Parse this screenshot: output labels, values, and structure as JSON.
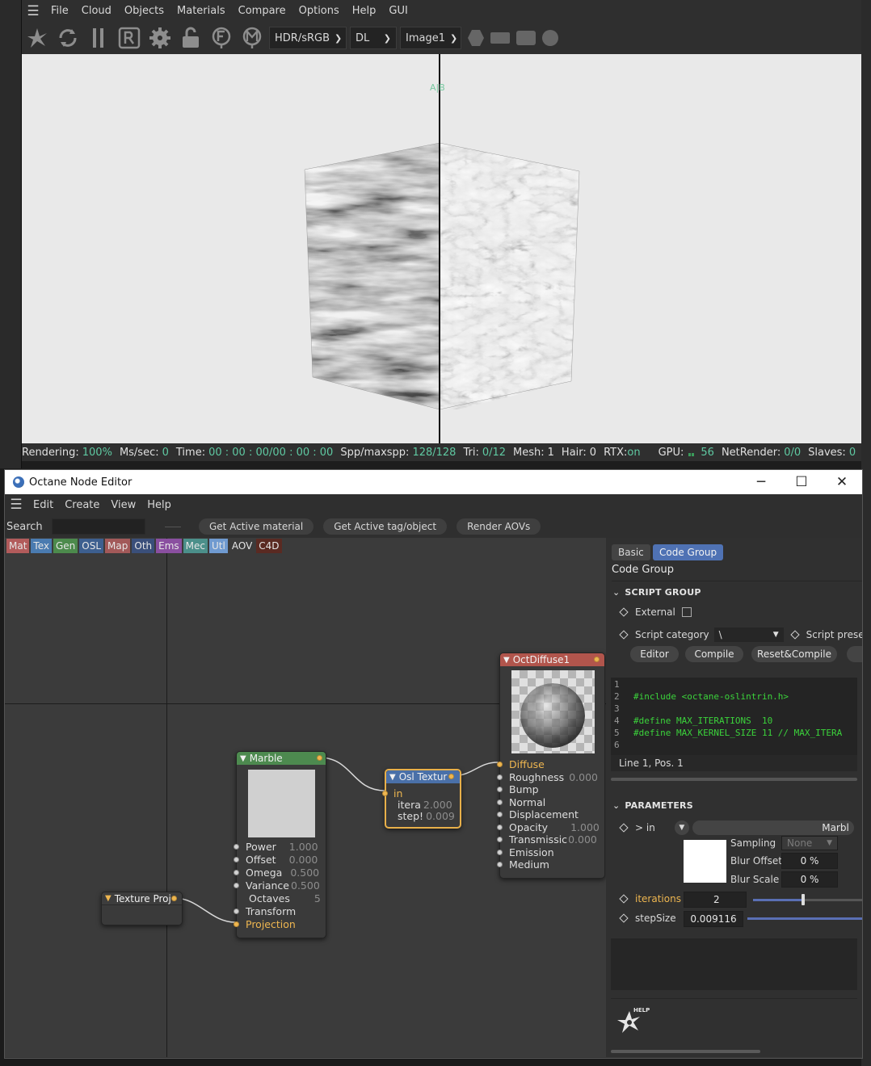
{
  "live_viewer": {
    "menu": [
      "File",
      "Cloud",
      "Objects",
      "Materials",
      "Compare",
      "Options",
      "Help",
      "GUI"
    ],
    "toolbar": {
      "color_space": "HDR/sRGB",
      "kernel": "DL",
      "image": "Image1"
    },
    "viewport": {
      "ab_label": "A|B"
    },
    "status": [
      {
        "label": "Rendering:",
        "value": "100%"
      },
      {
        "label": "Ms/sec:",
        "value": "0"
      },
      {
        "label": "Time:",
        "value": "00 : 00 : 00/00 : 00 : 00"
      },
      {
        "label": "Spp/maxspp:",
        "value": "128/128"
      },
      {
        "label": "Tri:",
        "value": "0/12"
      },
      {
        "label": "Mesh:",
        "value": "1"
      },
      {
        "label": "Hair:",
        "value": "0"
      },
      {
        "label": "RTX:",
        "value": "on"
      },
      {
        "label": "GPU:",
        "value": "56"
      },
      {
        "label": "NetRender:",
        "value": "0/0"
      },
      {
        "label": "Slaves:",
        "value": "0"
      }
    ]
  },
  "node_editor": {
    "title": "Octane Node Editor",
    "menu": [
      "Edit",
      "Create",
      "View",
      "Help"
    ],
    "toolbar": {
      "search_label": "Search",
      "search_value": "",
      "buttons": [
        "Get Active material",
        "Get Active tag/object",
        "Render AOVs"
      ]
    },
    "categories": [
      {
        "label": "Mat",
        "color": "#b25b5b"
      },
      {
        "label": "Tex",
        "color": "#4a7bb0"
      },
      {
        "label": "Gen",
        "color": "#4c8a4c"
      },
      {
        "label": "OSL",
        "color": "#3d5f8f"
      },
      {
        "label": "Map",
        "color": "#a25959"
      },
      {
        "label": "Oth",
        "color": "#3a4f7a"
      },
      {
        "label": "Ems",
        "color": "#8a4fa0"
      },
      {
        "label": "Mec",
        "color": "#4b8f8a"
      },
      {
        "label": "Utl",
        "color": "#6f9ad0"
      },
      {
        "label": "AOV",
        "color": "#3b3b3b"
      },
      {
        "label": "C4D",
        "color": "#5a2a22"
      }
    ],
    "nodes": {
      "diffuse": {
        "title": "OctDiffuse1",
        "pins": [
          {
            "label": "Diffuse",
            "value": "",
            "highlight": true
          },
          {
            "label": "Roughness",
            "value": "0.000"
          },
          {
            "label": "Bump",
            "value": ""
          },
          {
            "label": "Normal",
            "value": ""
          },
          {
            "label": "Displacement",
            "value": ""
          },
          {
            "label": "Opacity",
            "value": "1.000"
          },
          {
            "label": "Transmissic",
            "value": "0.000"
          },
          {
            "label": "Emission",
            "value": ""
          },
          {
            "label": "Medium",
            "value": ""
          }
        ]
      },
      "marble": {
        "title": "Marble",
        "pins": [
          {
            "label": "Power",
            "value": "1.000"
          },
          {
            "label": "Offset",
            "value": "0.000"
          },
          {
            "label": "Omega",
            "value": "0.500"
          },
          {
            "label": "Variance",
            "value": "0.500"
          },
          {
            "label": "Octaves",
            "value": "5"
          },
          {
            "label": "Transform",
            "value": ""
          },
          {
            "label": "Projection",
            "value": "",
            "highlight": true
          }
        ]
      },
      "osl": {
        "title": "Osl Textur",
        "pins": [
          {
            "label": "in",
            "value": "",
            "highlight": true
          },
          {
            "label": "itera",
            "value": "2.000"
          },
          {
            "label": "step!",
            "value": "0.009"
          }
        ]
      },
      "proj": {
        "title": "Texture Proj"
      }
    },
    "props": {
      "tabs": [
        "Basic",
        "Code Group"
      ],
      "panel_title": "Code Group",
      "script_group": "SCRIPT GROUP",
      "external_label": "External",
      "script_category_label": "Script category",
      "script_category_value": "\\",
      "script_presets_label": "Script presets",
      "buttons": [
        "Editor",
        "Compile",
        "Reset&Compile"
      ],
      "code": [
        {
          "n": "1",
          "t": ""
        },
        {
          "n": "2",
          "t": "#include <octane-oslintrin.h>"
        },
        {
          "n": "3",
          "t": ""
        },
        {
          "n": "4",
          "t": "#define MAX_ITERATIONS  10"
        },
        {
          "n": "5",
          "t": "#define MAX_KERNEL_SIZE 11 // MAX_ITERA"
        },
        {
          "n": "6",
          "t": ""
        }
      ],
      "cursor_pos": "Line 1, Pos. 1",
      "parameters": "PARAMETERS",
      "in_label": "> in",
      "in_value": "Marbl",
      "sampling_label": "Sampling",
      "sampling_value": "None",
      "blur_offset_label": "Blur Offset",
      "blur_offset_value": "0 %",
      "blur_scale_label": "Blur Scale",
      "blur_scale_value": "0 %",
      "iterations_label": "iterations",
      "iterations_value": "2",
      "iterations_fraction": 0.2,
      "stepsize_label": "stepSize",
      "stepsize_value": "0.009116",
      "help_label": "HELP"
    }
  }
}
